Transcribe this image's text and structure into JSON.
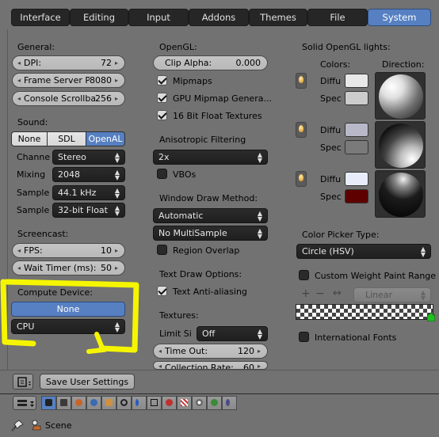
{
  "tabs": [
    {
      "label": "Interface",
      "active": false
    },
    {
      "label": "Editing",
      "active": false
    },
    {
      "label": "Input",
      "active": false
    },
    {
      "label": "Addons",
      "active": false
    },
    {
      "label": "Themes",
      "active": false
    },
    {
      "label": "File",
      "active": false
    },
    {
      "label": "System",
      "active": true
    }
  ],
  "general": {
    "title": "General:",
    "dpi": {
      "label": "DPI:",
      "value": "72"
    },
    "frame_server": {
      "label": "Frame Server P:",
      "value": "8080"
    },
    "console_scroll": {
      "label": "Console Scrollba:",
      "value": "256"
    }
  },
  "sound": {
    "title": "Sound:",
    "options": [
      "None",
      "SDL",
      "OpenAL"
    ],
    "selected": "OpenAL",
    "channels": {
      "label": "Channe",
      "value": "Stereo"
    },
    "mixing": {
      "label": "Mixing",
      "value": "2048"
    },
    "sample_rate": {
      "label": "Sample",
      "value": "44.1 kHz"
    },
    "sample_format": {
      "label": "Sample",
      "value": "32-bit Float"
    }
  },
  "screencast": {
    "title": "Screencast:",
    "fps": {
      "label": "FPS:",
      "value": "10"
    },
    "wait_timer": {
      "label": "Wait Timer (ms):",
      "value": "50"
    }
  },
  "compute": {
    "title": "Compute Device:",
    "none_label": "None",
    "device": "CPU"
  },
  "opengl": {
    "title": "OpenGL:",
    "clip_alpha": {
      "label": "Clip Alpha:",
      "value": "0.000"
    },
    "mipmaps": {
      "label": "Mipmaps",
      "checked": true
    },
    "gpu_mipmap": {
      "label": "GPU Mipmap Genera...",
      "checked": true
    },
    "float_textures": {
      "label": "16 Bit Float Textures",
      "checked": true
    }
  },
  "aniso": {
    "title": "Anisotropic Filtering",
    "value": "2x"
  },
  "vbos": {
    "label": "VBOs",
    "checked": false
  },
  "window_draw": {
    "title": "Window Draw Method:",
    "method": "Automatic",
    "multisample": "No MultiSample",
    "region_overlap": {
      "label": "Region Overlap",
      "checked": false
    }
  },
  "text_draw": {
    "title": "Text Draw Options:",
    "anti_alias": {
      "label": "Text Anti-aliasing",
      "checked": true
    }
  },
  "textures": {
    "title": "Textures:",
    "limit": {
      "label": "Limit Si",
      "value": "Off"
    },
    "timeout": {
      "label": "Time Out:",
      "value": "120"
    },
    "collection_rate": {
      "label": "Collection Rate:",
      "value": "60"
    }
  },
  "solid_lights": {
    "title": "Solid OpenGL lights:",
    "colors_header": "Colors:",
    "direction_header": "Direction:",
    "diffuse_label": "Diffu",
    "specular_label": "Spec",
    "lights": [
      {
        "diffuse": "#e8e8e8",
        "specular": "#cccccc"
      },
      {
        "diffuse": "#b8b8c8",
        "specular": "#7a7a7a"
      },
      {
        "diffuse": "#e8ecfa",
        "specular": "#5e0000"
      }
    ]
  },
  "color_picker": {
    "title": "Color Picker Type:",
    "value": "Circle (HSV)"
  },
  "weight_paint": {
    "label": "Custom Weight Paint Range",
    "checked": false
  },
  "ramp": {
    "add": "+",
    "remove": "−",
    "flip": "↔",
    "interp": "Linear"
  },
  "intl_fonts": {
    "label": "International Fonts",
    "checked": false
  },
  "footer": {
    "save_label": "Save User Settings"
  },
  "bottom": {
    "scene_label": "Scene"
  },
  "annotation_color": "#f5f500",
  "accent": "#5680c2"
}
